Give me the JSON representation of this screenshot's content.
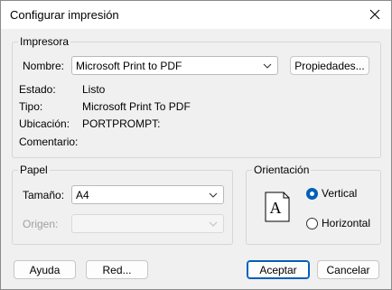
{
  "window": {
    "title": "Configurar impresión"
  },
  "printer_group": {
    "legend": "Impresora",
    "name_label": "Nombre:",
    "name_value": "Microsoft Print to PDF",
    "properties_button": "Propiedades...",
    "status_label": "Estado:",
    "status_value": "Listo",
    "type_label": "Tipo:",
    "type_value": "Microsoft Print To PDF",
    "location_label": "Ubicación:",
    "location_value": "PORTPROMPT:",
    "comment_label": "Comentario:",
    "comment_value": ""
  },
  "paper_group": {
    "legend": "Papel",
    "size_label": "Tamaño:",
    "size_value": "A4",
    "source_label": "Origen:",
    "source_value": ""
  },
  "orientation_group": {
    "legend": "Orientación",
    "preview_letter": "A",
    "options": [
      {
        "label": "Vertical",
        "checked": true
      },
      {
        "label": "Horizontal",
        "checked": false
      }
    ]
  },
  "buttons": {
    "help": "Ayuda",
    "network": "Red...",
    "ok": "Aceptar",
    "cancel": "Cancelar"
  },
  "colors": {
    "accent": "#005fb8",
    "background": "#f0f0f0"
  }
}
